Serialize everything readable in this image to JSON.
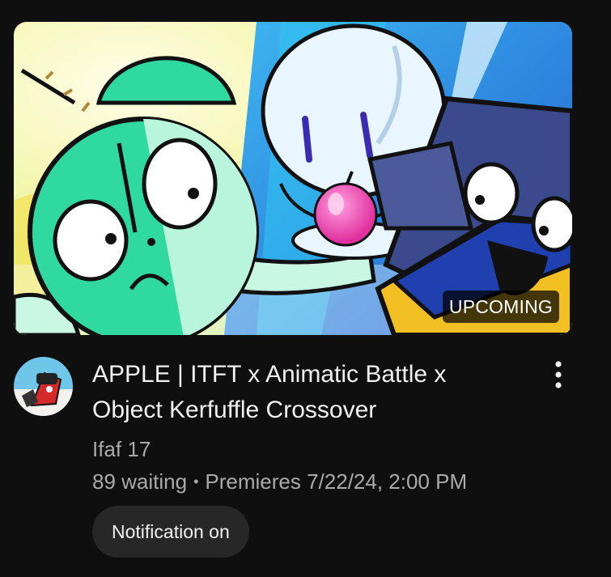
{
  "video": {
    "title": "APPLE | ITFT x Animatic Battle x Object Kerfuffle Crossover",
    "badge": "UPCOMING",
    "channel": "Ifaf 17",
    "waiting": "89 waiting",
    "separator": "•",
    "premiere": "Premieres 7/22/24, 2:00 PM",
    "notification_label": "Notification on"
  },
  "icons": {
    "more": "more-vert-icon"
  },
  "colors": {
    "background": "#0f0f0f",
    "primary_text": "#f1f1f1",
    "secondary_text": "#aaaaaa",
    "button_bg": "#272727",
    "badge_bg": "#000000"
  }
}
